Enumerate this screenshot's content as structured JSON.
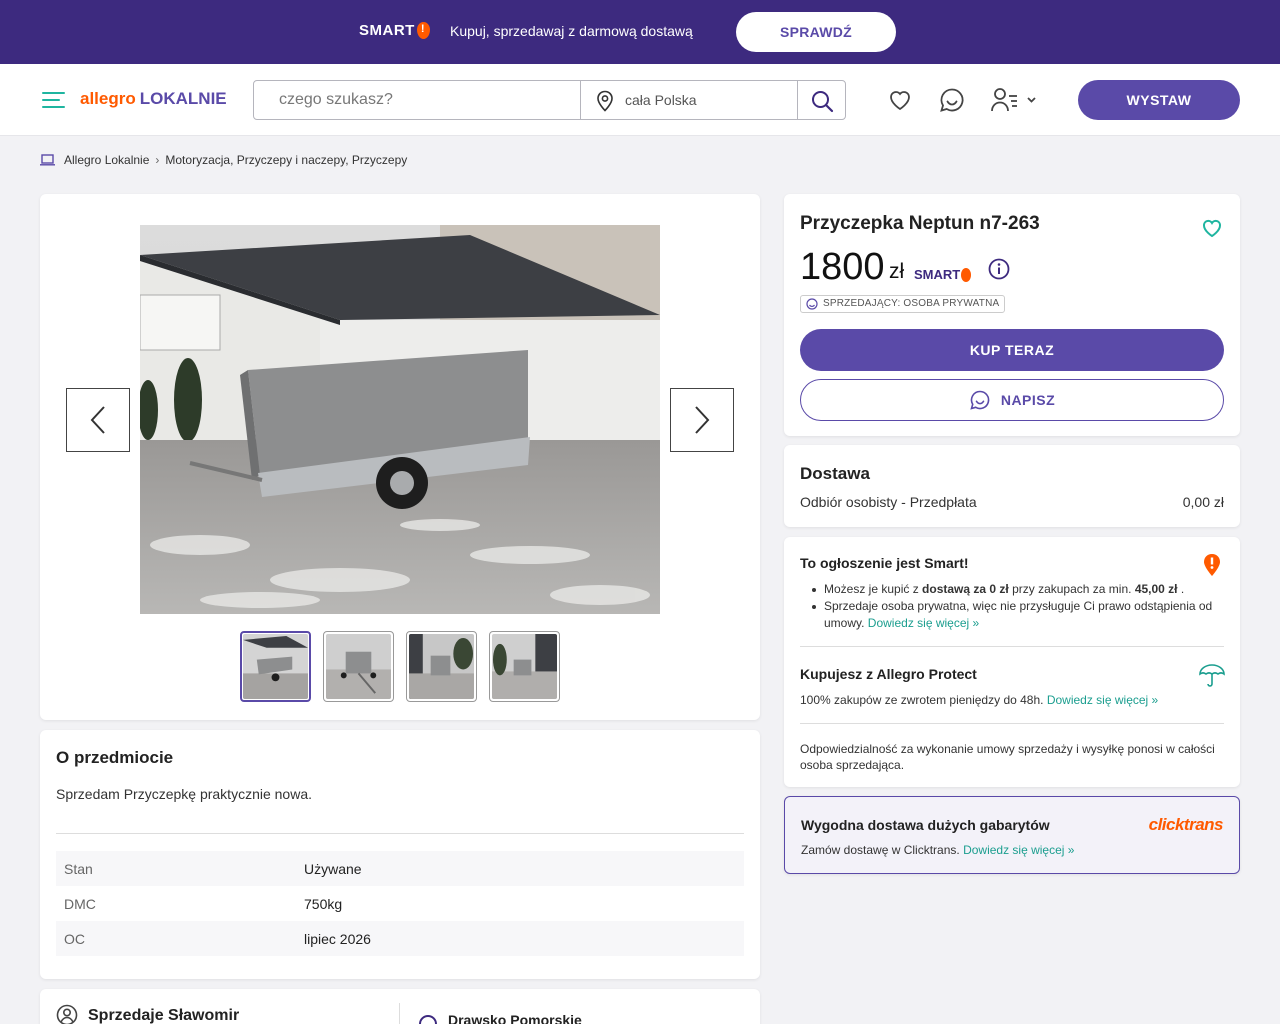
{
  "promo": {
    "logo_text": "SMART",
    "text": "Kupuj, sprzedawaj z darmową dostawą",
    "button": "SPRAWDŹ"
  },
  "header": {
    "logo_part1": "allegro",
    "logo_part2": "LOKALNIE",
    "search_placeholder": "czego szukasz?",
    "location_placeholder": "cała Polska",
    "list_button": "WYSTAW"
  },
  "breadcrumb": {
    "items": [
      "Allegro Lokalnie",
      "Motoryzacja, Przyczepy i naczepy, Przyczepy"
    ]
  },
  "gallery": {
    "thumbnail_count": 4,
    "active_index": 0
  },
  "about": {
    "heading": "O przedmiocie",
    "description": "Sprzedam Przyczepkę praktycznie nowa.",
    "params": [
      {
        "key": "Stan",
        "value": "Używane"
      },
      {
        "key": "DMC",
        "value": "750kg"
      },
      {
        "key": "OC",
        "value": "lipiec 2026"
      }
    ]
  },
  "seller": {
    "name": "Sprzedaje Sławomir",
    "city": "Drawsko Pomorskie"
  },
  "offer": {
    "title": "Przyczepka Neptun n7-263",
    "price": "1800",
    "currency": "zł",
    "smart_badge": "SMART",
    "seller_type": "SPRZEDAJĄCY: OSOBA PRYWATNA",
    "buy_button": "KUP TERAZ",
    "message_button": "NAPISZ"
  },
  "delivery": {
    "heading": "Dostawa",
    "option": "Odbiór osobisty - Przedpłata",
    "cost": "0,00 zł"
  },
  "smart_info": {
    "heading": "To ogłoszenie jest Smart!",
    "bullet1_a": "Możesz je kupić z ",
    "bullet1_b": "dostawą za 0 zł",
    "bullet1_c": " przy zakupach za min. ",
    "bullet1_d": "45,00 zł",
    "bullet1_e": " .",
    "bullet2": "Sprzedaje osoba prywatna, więc nie przysługuje Ci prawo odstąpienia od umowy.",
    "bullet2_link": "Dowiedz się więcej »",
    "protect_heading": "Kupujesz z Allegro Protect",
    "protect_text": "100% zakupów ze zwrotem pieniędzy do 48h.",
    "protect_link": "Dowiedz się więcej »",
    "liability": "Odpowiedzialność za wykonanie umowy sprzedaży i wysyłkę ponosi w całości osoba sprzedająca."
  },
  "clicktrans": {
    "heading": "Wygodna dostawa dużych gabarytów",
    "text": "Zamów dostawę w Clicktrans.",
    "link": "Dowiedz się więcej »",
    "brand": "clicktrans"
  },
  "colors": {
    "brand_purple": "#5a4aa8",
    "banner_purple": "#3d2a7f",
    "accent_orange": "#ff5a00",
    "link_teal": "#1b9e8f"
  }
}
